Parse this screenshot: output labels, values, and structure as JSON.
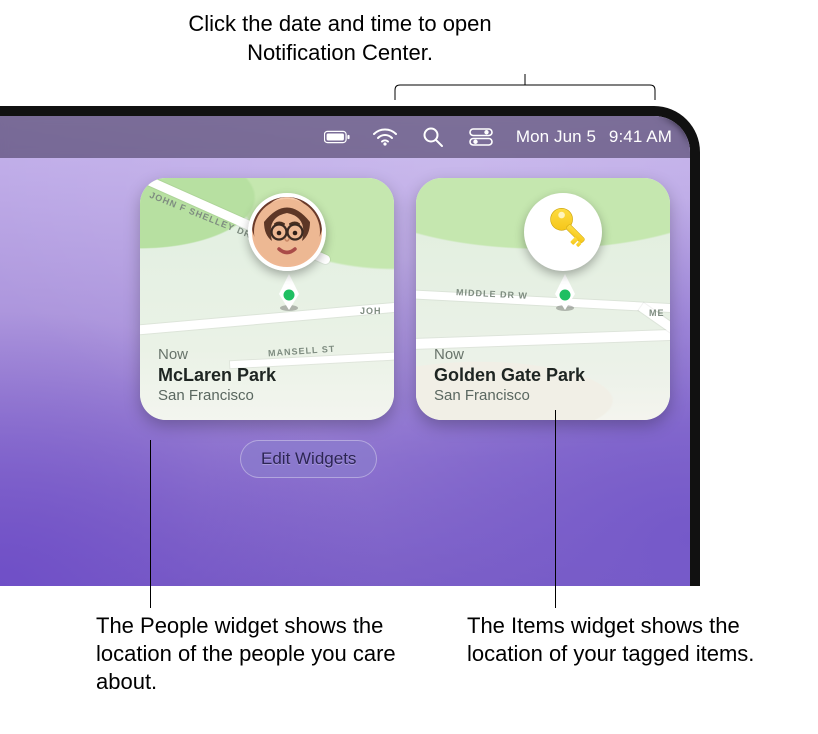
{
  "callouts": {
    "top": "Click the date and time to open Notification Center.",
    "bottom_left": "The People widget shows the location of the people you care about.",
    "bottom_right": "The Items widget shows the location of your tagged items."
  },
  "menubar": {
    "icons": [
      "battery-icon",
      "wifi-icon",
      "search-icon",
      "control-center-icon"
    ],
    "date": "Mon Jun 5",
    "time": "9:41 AM"
  },
  "widgets": {
    "people": {
      "now_label": "Now",
      "location": "McLaren Park",
      "city": "San Francisco",
      "streets": [
        "JOHN F SHELLEY DR",
        "JOH",
        "MANSELL ST"
      ]
    },
    "items": {
      "now_label": "Now",
      "location": "Golden Gate Park",
      "city": "San Francisco",
      "streets": [
        "MIDDLE DR W",
        "ME"
      ]
    }
  },
  "edit_widgets_label": "Edit Widgets",
  "colors": {
    "widget_green": "#1fbf62",
    "key_yellow_a": "#ffe14a",
    "key_yellow_b": "#f4c212"
  }
}
